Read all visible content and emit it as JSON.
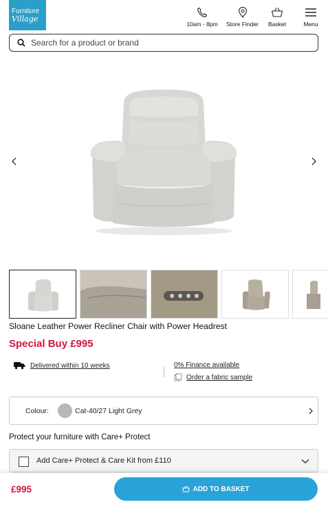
{
  "header": {
    "logo_line1": "Furniture",
    "logo_line2": "Village",
    "nav": {
      "hours": "10am - 8pm",
      "store_finder": "Store Finder",
      "basket": "Basket",
      "menu": "Menu"
    }
  },
  "search": {
    "placeholder": "Search for a product or brand"
  },
  "product": {
    "title": "Sloane Leather Power Recliner Chair with Power Headrest",
    "price": "Special Buy £995",
    "delivery": "Delivered within 10 weeks",
    "finance": "0% Finance available",
    "fabric_sample": "Order a fabric sample",
    "colour_label": "Colour:",
    "colour_value": "Cat-40/27 Light Grey",
    "colour_swatch": "#b8b7b2"
  },
  "care": {
    "title": "Protect your furniture with Care+ Protect",
    "option": "Add Care+ Protect & Care Kit from £110"
  },
  "bottom": {
    "price": "£995",
    "add_to_basket": "ADD TO BASKET"
  },
  "colors": {
    "brand": "#2a9fc9",
    "price": "#d6133f",
    "button": "#2aa3d8"
  }
}
